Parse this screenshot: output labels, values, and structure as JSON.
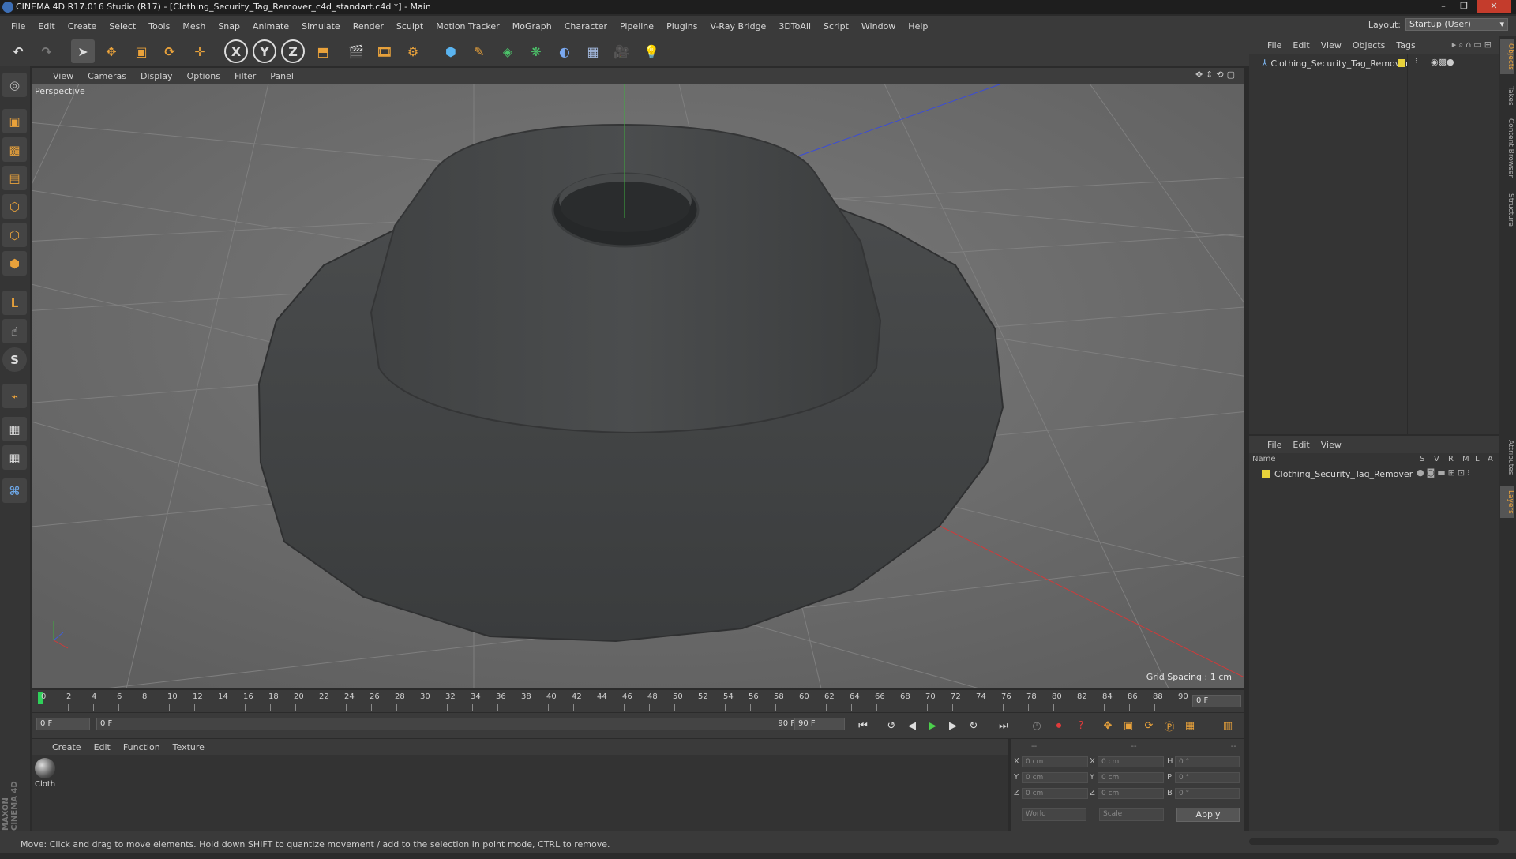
{
  "window": {
    "title": "CINEMA 4D R17.016 Studio (R17) - [Clothing_Security_Tag_Remover_c4d_standart.c4d *] - Main",
    "controls": [
      "–",
      "❐",
      "✕"
    ]
  },
  "menubar": {
    "items": [
      "File",
      "Edit",
      "Create",
      "Select",
      "Tools",
      "Mesh",
      "Snap",
      "Animate",
      "Simulate",
      "Render",
      "Sculpt",
      "Motion Tracker",
      "MoGraph",
      "Character",
      "Pipeline",
      "Plugins",
      "V-Ray Bridge",
      "3DToAll",
      "Script",
      "Window",
      "Help"
    ],
    "layout_label": "Layout:",
    "layout_value": "Startup (User)"
  },
  "toolbar": {
    "axis_x": "X",
    "axis_y": "Y",
    "axis_z": "Z"
  },
  "viewport": {
    "menu": [
      "View",
      "Cameras",
      "Display",
      "Options",
      "Filter",
      "Panel"
    ],
    "camera_label": "Perspective",
    "grid_spacing": "Grid Spacing : 1 cm"
  },
  "timeline": {
    "ticks": [
      "0",
      "2",
      "4",
      "6",
      "8",
      "10",
      "12",
      "14",
      "16",
      "18",
      "20",
      "22",
      "24",
      "26",
      "28",
      "30",
      "32",
      "34",
      "36",
      "38",
      "40",
      "42",
      "44",
      "46",
      "48",
      "50",
      "52",
      "54",
      "56",
      "58",
      "60",
      "62",
      "64",
      "66",
      "68",
      "70",
      "72",
      "74",
      "76",
      "78",
      "80",
      "82",
      "84",
      "86",
      "88",
      "90"
    ],
    "current_frame": "0 F",
    "start_field": "0 F",
    "range_start": "0 F",
    "range_end": "90 F",
    "end_field": "90 F"
  },
  "material_manager": {
    "menu": [
      "Create",
      "Edit",
      "Function",
      "Texture"
    ],
    "material_name": "Cloth"
  },
  "coordinates": {
    "header": [
      "--",
      "--",
      "--"
    ],
    "rows": [
      {
        "a": "X",
        "av": "0 cm",
        "b": "X",
        "bv": "0 cm",
        "c": "H",
        "cv": "0 °"
      },
      {
        "a": "Y",
        "av": "0 cm",
        "b": "Y",
        "bv": "0 cm",
        "c": "P",
        "cv": "0 °"
      },
      {
        "a": "Z",
        "av": "0 cm",
        "b": "Z",
        "bv": "0 cm",
        "c": "B",
        "cv": "0 °"
      }
    ],
    "space": "World",
    "mode": "Scale",
    "apply": "Apply"
  },
  "object_manager": {
    "menu": [
      "File",
      "Edit",
      "View",
      "Objects",
      "Tags"
    ],
    "object_name": "Clothing_Security_Tag_Remover"
  },
  "layer_manager": {
    "menu": [
      "File",
      "Edit",
      "View"
    ],
    "columns": [
      "Name",
      "S",
      "V",
      "R",
      "M",
      "L",
      "A"
    ],
    "layer_name": "Clothing_Security_Tag_Remover"
  },
  "right_tabs": [
    "Objects",
    "Takes",
    "Content Browser",
    "Structure",
    "Attributes",
    "Layers"
  ],
  "brand": "MAXON CINEMA 4D",
  "status": "Move: Click and drag to move elements. Hold down SHIFT to quantize movement / add to the selection in point mode, CTRL to remove.",
  "colors": {
    "accent": "#e9a23b",
    "layer_color": "#e8d23a",
    "axis_x": "#d23c3c",
    "axis_y": "#3fae3f",
    "axis_z": "#4060d8"
  }
}
